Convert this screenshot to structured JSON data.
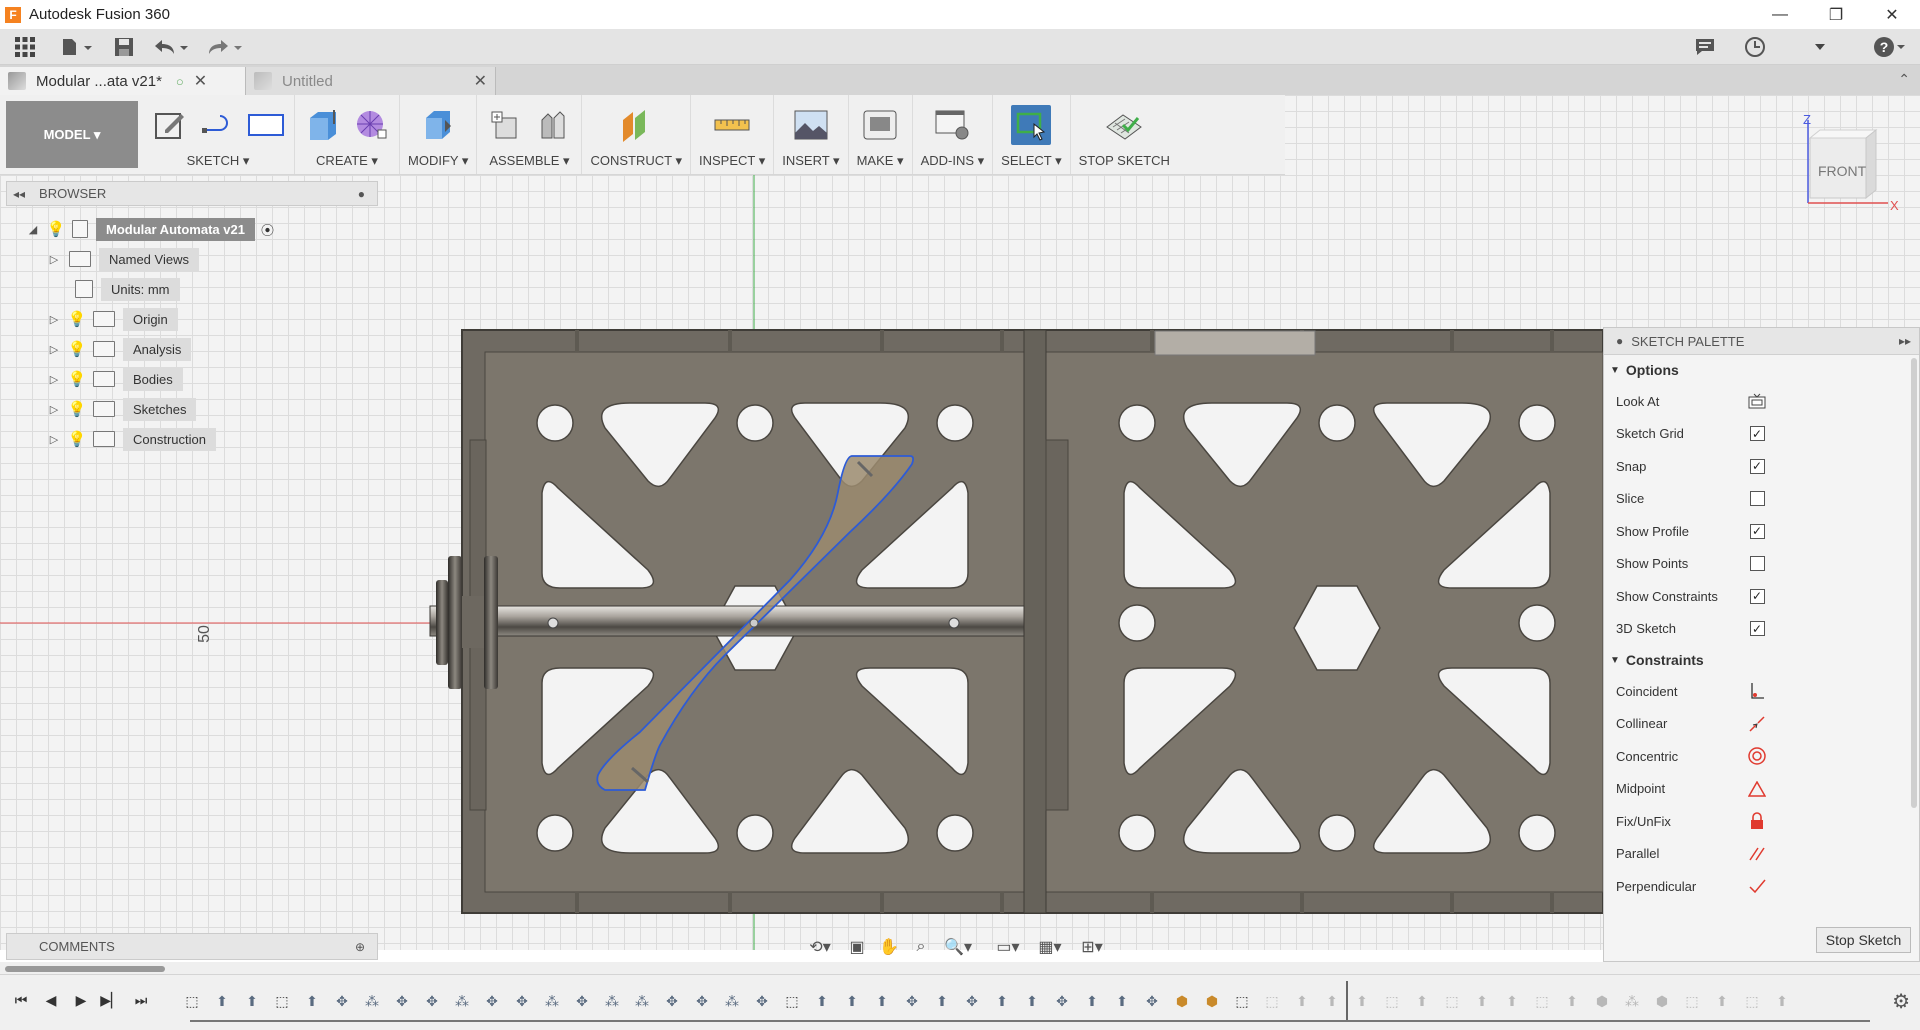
{
  "window": {
    "title": "Autodesk Fusion 360",
    "logo_letter": "F",
    "controls": {
      "minimize": "—",
      "restore": "❐",
      "close": "✕"
    }
  },
  "tabs": [
    {
      "label": "Modular ...ata v21*",
      "active": true
    },
    {
      "label": "Untitled",
      "active": false
    }
  ],
  "toolbar": {
    "workspace_label": "MODEL ▾",
    "groups": [
      {
        "label": "SKETCH ▾",
        "icons": [
          "create-sketch-icon",
          "line-icon",
          "rectangle-icon"
        ]
      },
      {
        "label": "CREATE ▾",
        "icons": [
          "extrude-icon",
          "form-icon"
        ]
      },
      {
        "label": "MODIFY ▾",
        "icons": [
          "press-pull-icon"
        ]
      },
      {
        "label": "ASSEMBLE ▾",
        "icons": [
          "new-component-icon",
          "joint-icon"
        ]
      },
      {
        "label": "CONSTRUCT ▾",
        "icons": [
          "offset-plane-icon"
        ]
      },
      {
        "label": "INSPECT ▾",
        "icons": [
          "measure-icon"
        ]
      },
      {
        "label": "INSERT ▾",
        "icons": [
          "attached-canvas-icon"
        ]
      },
      {
        "label": "MAKE ▾",
        "icons": [
          "print-3d-icon"
        ]
      },
      {
        "label": "ADD-INS ▾",
        "icons": [
          "scripts-icon"
        ]
      },
      {
        "label": "SELECT ▾",
        "icons": [
          "select-icon"
        ]
      },
      {
        "label": "STOP SKETCH",
        "icons": [
          "stop-sketch-icon"
        ]
      }
    ]
  },
  "viewcube": {
    "face": "FRONT",
    "axis_z": "Z",
    "axis_x": "X"
  },
  "browser": {
    "title": "BROWSER",
    "root": "Modular Automata v21",
    "items": [
      {
        "label": "Named Views",
        "bulb": false
      },
      {
        "label": "Units: mm",
        "bulb": false
      },
      {
        "label": "Origin",
        "bulb": true,
        "bulb_color": "#5b8fd9"
      },
      {
        "label": "Analysis",
        "bulb": true,
        "bulb_color": "#e2b900"
      },
      {
        "label": "Bodies",
        "bulb": true,
        "bulb_color": "#e2b900"
      },
      {
        "label": "Sketches",
        "bulb": true,
        "bulb_color": "#e2b900"
      },
      {
        "label": "Construction",
        "bulb": true,
        "bulb_color": "#e2b900"
      }
    ]
  },
  "viewport": {
    "dimension_label": "50"
  },
  "comments": {
    "title": "COMMENTS"
  },
  "sketch_palette": {
    "title": "SKETCH PALETTE",
    "options_title": "Options",
    "options": [
      {
        "label": "Look At",
        "control": "look-at"
      },
      {
        "label": "Sketch Grid",
        "checked": true
      },
      {
        "label": "Snap",
        "checked": true
      },
      {
        "label": "Slice",
        "checked": false
      },
      {
        "label": "Show Profile",
        "checked": true
      },
      {
        "label": "Show Points",
        "checked": false
      },
      {
        "label": "Show Constraints",
        "checked": true
      },
      {
        "label": "3D Sketch",
        "checked": true
      }
    ],
    "constraints_title": "Constraints",
    "constraints": [
      {
        "label": "Coincident",
        "glyph": "∟",
        "color": "#333333"
      },
      {
        "label": "Collinear",
        "glyph": "⚡",
        "color": "#333333"
      },
      {
        "label": "Concentric",
        "glyph": "◎",
        "color": "#e03a2f"
      },
      {
        "label": "Midpoint",
        "glyph": "△",
        "color": "#e03a2f"
      },
      {
        "label": "Fix/UnFix",
        "glyph": "🔒",
        "color": "#e03a2f"
      },
      {
        "label": "Parallel",
        "glyph": "//",
        "color": "#e03a2f"
      },
      {
        "label": "Perpendicular",
        "glyph": "✓",
        "color": "#e03a2f"
      }
    ],
    "stop_label": "Stop Sketch"
  },
  "colors": {
    "plate": "#7c766c",
    "plate_dark": "#5e5a52",
    "slot_fill": "#9b8b6f",
    "sketch_line": "#2d5bd6",
    "axis_red": "#e05050",
    "axis_green": "#3fae49",
    "select_blue": "#3f7ab8"
  }
}
